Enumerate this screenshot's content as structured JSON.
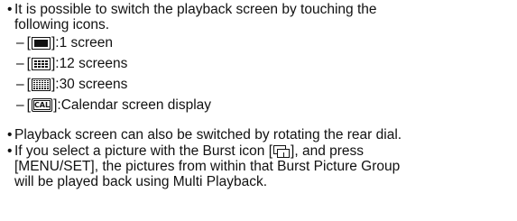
{
  "bullet_char": "•",
  "intro": {
    "line1": "It is possible to switch the playback screen by touching the",
    "line2": "following icons."
  },
  "options": [
    {
      "dash": "–",
      "open": "[",
      "close": "]: ",
      "icon": "single-screen-icon",
      "label": "1 screen"
    },
    {
      "dash": "–",
      "open": "[",
      "close": "]: ",
      "icon": "12-screens-icon",
      "label": "12 screens"
    },
    {
      "dash": "–",
      "open": "[",
      "close": "]: ",
      "icon": "30-screens-icon",
      "label": "30 screens"
    },
    {
      "dash": "–",
      "open": "[",
      "close": "]: ",
      "icon": "calendar-icon",
      "icon_text": "CAL",
      "label": "Calendar screen display"
    }
  ],
  "note_dial": "Playback screen can also be switched by rotating the rear dial.",
  "note_burst": {
    "line1_before": "If you select a picture with the Burst icon [",
    "line1_after": "], and press",
    "line2": "[MENU/SET], the pictures from within that Burst Picture Group",
    "line3": "will be played back using Multi Playback.",
    "icon": "burst-icon"
  }
}
